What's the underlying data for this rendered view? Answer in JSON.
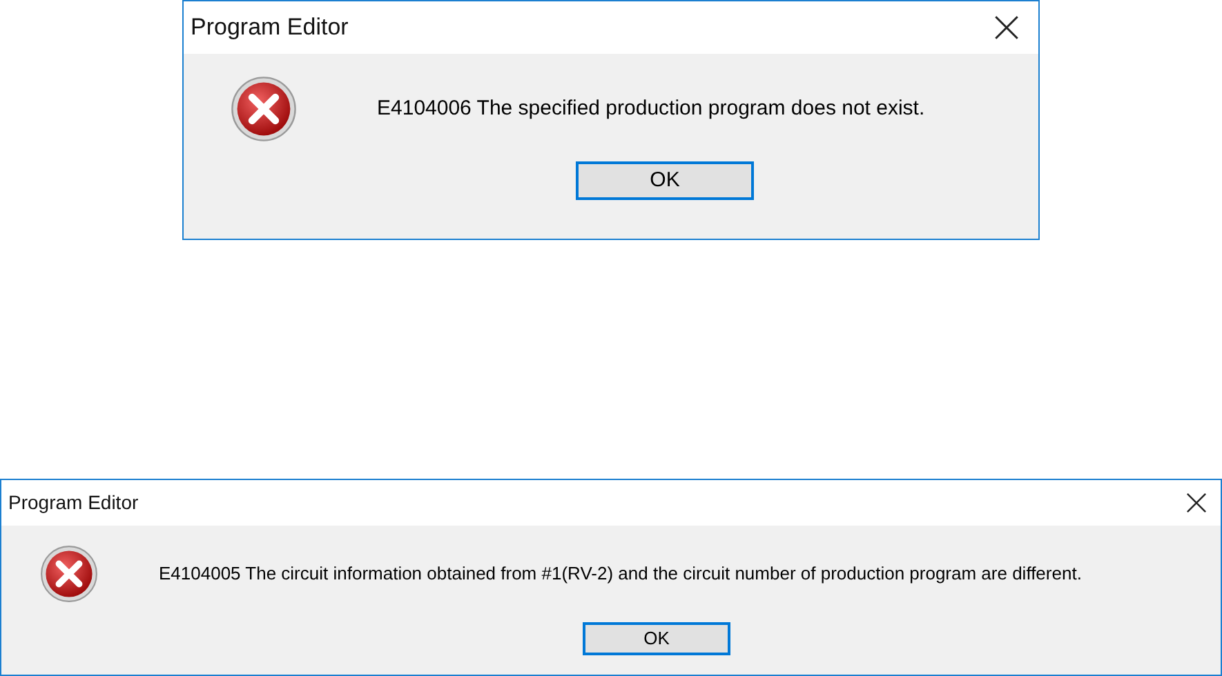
{
  "dialogs": [
    {
      "kind": "large",
      "title": "Program Editor",
      "message": "E4104006 The specified production program does not exist.",
      "button": "OK"
    },
    {
      "kind": "compact",
      "title": "Program Editor",
      "message": "E4104005 The circuit information obtained from #1(RV-2) and the circuit number of production program are different.",
      "button": "OK"
    }
  ]
}
